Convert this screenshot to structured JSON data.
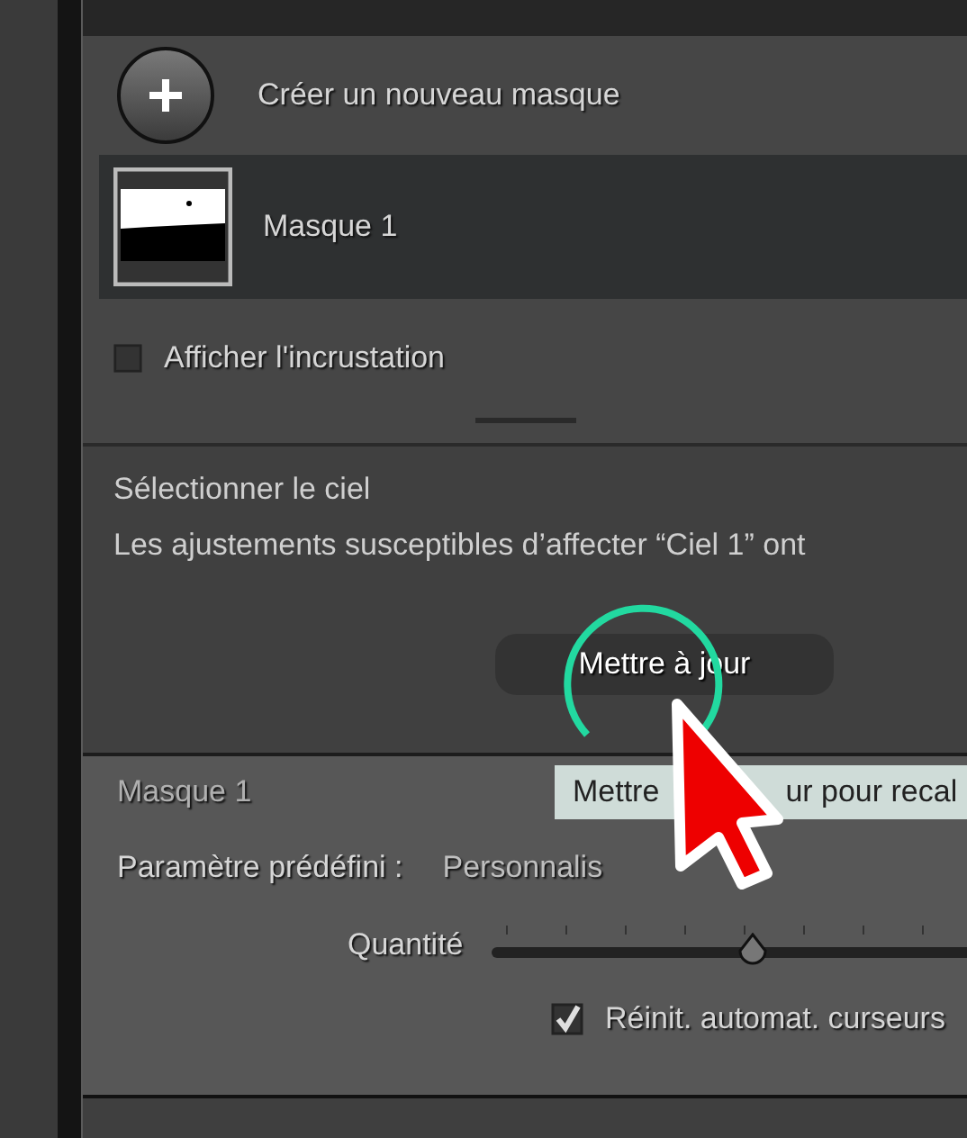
{
  "create": {
    "label": "Créer un nouveau masque"
  },
  "masks": [
    {
      "name": "Masque 1",
      "selected": true
    }
  ],
  "overlay": {
    "label": "Afficher l'incrustation",
    "checked": false
  },
  "sky_section": {
    "title": "Sélectionner le ciel",
    "message": "Les ajustements susceptibles d’affecter “Ciel 1” ont",
    "update_button": "Mettre à jour"
  },
  "tooltip": {
    "parts": [
      "Mettre",
      "ur pour recal"
    ]
  },
  "mask_panel": {
    "title": "Masque 1",
    "preset_label": "Paramètre prédéfini :",
    "preset_value": "Personnalis",
    "amount": {
      "label": "Quantité",
      "level": 0.5
    },
    "auto_reset": {
      "label": "Réinit. automat. curseurs",
      "checked": true
    }
  }
}
